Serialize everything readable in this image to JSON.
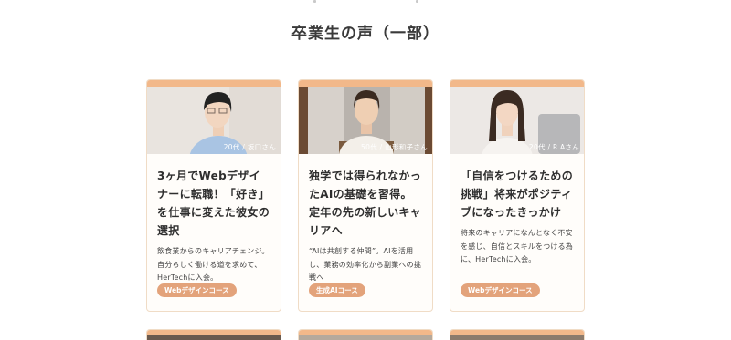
{
  "section": {
    "title": "卒業生の声（一部）"
  },
  "cards": [
    {
      "caption": "20代 / 坂口さん",
      "title": "3ヶ月でWebデザイナーに転職！「好き」を仕事に変えた彼女の選択",
      "description": "飲食業からのキャリアチェンジ。自分らしく働ける道を求めて、HerTechに入会。",
      "course": "Webデザインコース"
    },
    {
      "caption": "50代 / 山形和子さん",
      "title": "独学では得られなかったAIの基礎を習得。定年の先の新しいキャリアへ",
      "description": "“AIは共創する仲間”。AIを活用し、業務の効率化から副業への挑戦へ",
      "course": "生成AIコース"
    },
    {
      "caption": "20代 / R.Aさん",
      "title": "「自信をつけるための挑戦」将来がポジティブになったきっかけ",
      "description": "将来のキャリアになんとなく不安を感じ、自信とスキルをつける為に、HerTechに入会。",
      "course": "Webデザインコース"
    }
  ],
  "colors": {
    "accent": "#f2b88a",
    "tag": "#e3a37b",
    "border": "#f0dcc6"
  }
}
